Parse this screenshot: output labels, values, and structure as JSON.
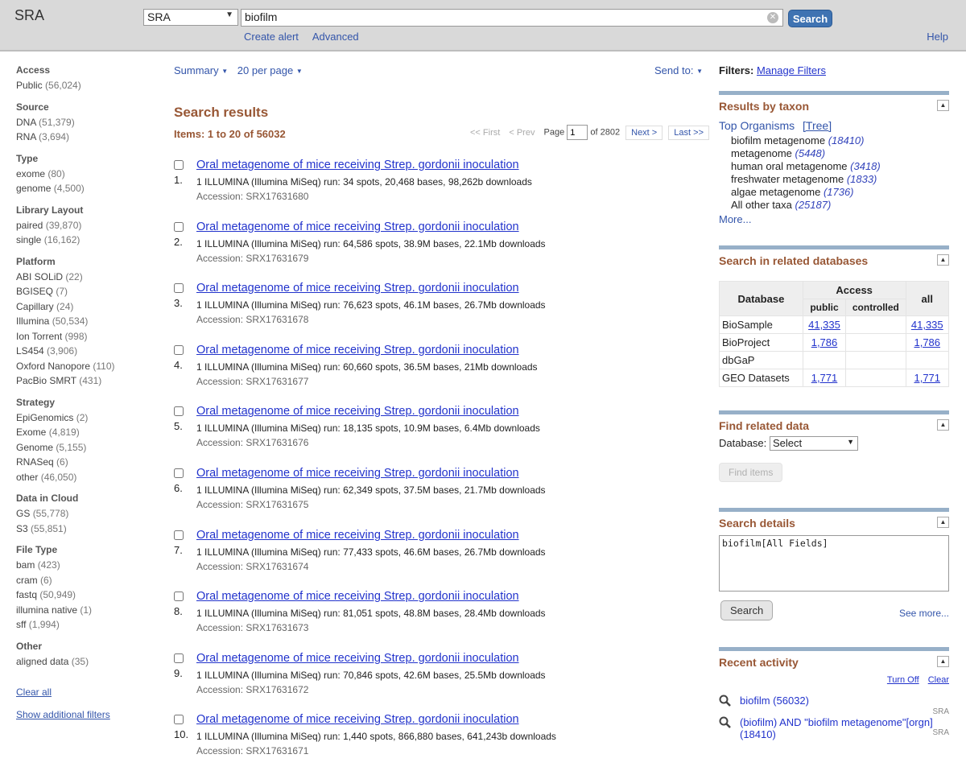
{
  "header": {
    "logo": "SRA",
    "db_selected": "SRA",
    "search_value": "biofilm",
    "search_button": "Search",
    "links": [
      "Create alert",
      "Advanced"
    ],
    "help": "Help"
  },
  "facets": [
    {
      "title": "Access",
      "items": [
        {
          "label": "Public",
          "count": "(56,024)"
        }
      ]
    },
    {
      "title": "Source",
      "items": [
        {
          "label": "DNA",
          "count": "(51,379)"
        },
        {
          "label": "RNA",
          "count": "(3,694)"
        }
      ]
    },
    {
      "title": "Type",
      "items": [
        {
          "label": "exome",
          "count": "(80)"
        },
        {
          "label": "genome",
          "count": "(4,500)"
        }
      ]
    },
    {
      "title": "Library Layout",
      "items": [
        {
          "label": "paired",
          "count": "(39,870)"
        },
        {
          "label": "single",
          "count": "(16,162)"
        }
      ]
    },
    {
      "title": "Platform",
      "items": [
        {
          "label": "ABI SOLiD",
          "count": "(22)"
        },
        {
          "label": "BGISEQ",
          "count": "(7)"
        },
        {
          "label": "Capillary",
          "count": "(24)"
        },
        {
          "label": "Illumina",
          "count": "(50,534)"
        },
        {
          "label": "Ion Torrent",
          "count": "(998)"
        },
        {
          "label": "LS454",
          "count": "(3,906)"
        },
        {
          "label": "Oxford Nanopore",
          "count": "(110)"
        },
        {
          "label": "PacBio SMRT",
          "count": "(431)"
        }
      ]
    },
    {
      "title": "Strategy",
      "items": [
        {
          "label": "EpiGenomics",
          "count": "(2)"
        },
        {
          "label": "Exome",
          "count": "(4,819)"
        },
        {
          "label": "Genome",
          "count": "(5,155)"
        },
        {
          "label": "RNASeq",
          "count": "(6)"
        },
        {
          "label": "other",
          "count": "(46,050)"
        }
      ]
    },
    {
      "title": "Data in Cloud",
      "items": [
        {
          "label": "GS",
          "count": "(55,778)"
        },
        {
          "label": "S3",
          "count": "(55,851)"
        }
      ]
    },
    {
      "title": "File Type",
      "items": [
        {
          "label": "bam",
          "count": "(423)"
        },
        {
          "label": "cram",
          "count": "(6)"
        },
        {
          "label": "fastq",
          "count": "(50,949)"
        },
        {
          "label": "illumina native",
          "count": "(1)"
        },
        {
          "label": "sff",
          "count": "(1,994)"
        }
      ]
    },
    {
      "title": "Other",
      "items": [
        {
          "label": "aligned data",
          "count": "(35)"
        }
      ]
    }
  ],
  "facet_links": {
    "clear_all": "Clear all",
    "show_additional": "Show additional filters"
  },
  "toolbar": {
    "summary": "Summary",
    "per_page": "20 per page",
    "send_to": "Send to:"
  },
  "results_title": "Search results",
  "items_label": "Items: 1 to 20 of 56032",
  "pager": {
    "first": "<< First",
    "prev": "< Prev",
    "page_label": "Page",
    "page_value": "1",
    "of": "of 2802",
    "next": "Next >",
    "last": "Last >>"
  },
  "results": [
    {
      "num": "1.",
      "title": "Oral metagenome of mice receiving Strep. gordonii inoculation",
      "desc": "1 ILLUMINA (Illumina MiSeq) run: 34 spots, 20,468 bases, 98,262b downloads",
      "accession": "Accession: SRX17631680"
    },
    {
      "num": "2.",
      "title": "Oral metagenome of mice receiving Strep. gordonii inoculation",
      "desc": "1 ILLUMINA (Illumina MiSeq) run: 64,586 spots, 38.9M bases, 22.1Mb downloads",
      "accession": "Accession: SRX17631679"
    },
    {
      "num": "3.",
      "title": "Oral metagenome of mice receiving Strep. gordonii inoculation",
      "desc": "1 ILLUMINA (Illumina MiSeq) run: 76,623 spots, 46.1M bases, 26.7Mb downloads",
      "accession": "Accession: SRX17631678"
    },
    {
      "num": "4.",
      "title": "Oral metagenome of mice receiving Strep. gordonii inoculation",
      "desc": "1 ILLUMINA (Illumina MiSeq) run: 60,660 spots, 36.5M bases, 21Mb downloads",
      "accession": "Accession: SRX17631677"
    },
    {
      "num": "5.",
      "title": "Oral metagenome of mice receiving Strep. gordonii inoculation",
      "desc": "1 ILLUMINA (Illumina MiSeq) run: 18,135 spots, 10.9M bases, 6.4Mb downloads",
      "accession": "Accession: SRX17631676"
    },
    {
      "num": "6.",
      "title": "Oral metagenome of mice receiving Strep. gordonii inoculation",
      "desc": "1 ILLUMINA (Illumina MiSeq) run: 62,349 spots, 37.5M bases, 21.7Mb downloads",
      "accession": "Accession: SRX17631675"
    },
    {
      "num": "7.",
      "title": "Oral metagenome of mice receiving Strep. gordonii inoculation",
      "desc": "1 ILLUMINA (Illumina MiSeq) run: 77,433 spots, 46.6M bases, 26.7Mb downloads",
      "accession": "Accession: SRX17631674"
    },
    {
      "num": "8.",
      "title": "Oral metagenome of mice receiving Strep. gordonii inoculation",
      "desc": "1 ILLUMINA (Illumina MiSeq) run: 81,051 spots, 48.8M bases, 28.4Mb downloads",
      "accession": "Accession: SRX17631673"
    },
    {
      "num": "9.",
      "title": "Oral metagenome of mice receiving Strep. gordonii inoculation",
      "desc": "1 ILLUMINA (Illumina MiSeq) run: 70,846 spots, 42.6M bases, 25.5Mb downloads",
      "accession": "Accession: SRX17631672"
    },
    {
      "num": "10.",
      "title": "Oral metagenome of mice receiving Strep. gordonii inoculation",
      "desc": "1 ILLUMINA (Illumina MiSeq) run: 1,440 spots, 866,880 bases, 641,243b downloads",
      "accession": "Accession: SRX17631671"
    }
  ],
  "right": {
    "filters_label": "Filters:",
    "manage_filters": "Manage Filters",
    "taxon": {
      "title": "Results by taxon",
      "top_organisms": "Top Organisms",
      "tree": "[Tree]",
      "organisms": [
        {
          "name": "biofilm metagenome",
          "count": "(18410)"
        },
        {
          "name": "metagenome",
          "count": "(5448)"
        },
        {
          "name": "human oral metagenome",
          "count": "(3418)"
        },
        {
          "name": "freshwater metagenome",
          "count": "(1833)"
        },
        {
          "name": "algae metagenome",
          "count": "(1736)"
        },
        {
          "name": "All other taxa",
          "count": "(25187)"
        }
      ],
      "more": "More..."
    },
    "related": {
      "title": "Search in related databases",
      "headers": {
        "database": "Database",
        "access": "Access",
        "public": "public",
        "controlled": "controlled",
        "all": "all"
      },
      "rows": [
        {
          "db": "BioSample",
          "public": "41,335",
          "controlled": "",
          "all": "41,335"
        },
        {
          "db": "BioProject",
          "public": "1,786",
          "controlled": "",
          "all": "1,786"
        },
        {
          "db": "dbGaP",
          "public": "",
          "controlled": "",
          "all": ""
        },
        {
          "db": "GEO Datasets",
          "public": "1,771",
          "controlled": "",
          "all": "1,771"
        }
      ]
    },
    "find_related": {
      "title": "Find related data",
      "db_label": "Database:",
      "db_selected": "Select",
      "find_button": "Find items"
    },
    "search_details": {
      "title": "Search details",
      "query": "biofilm[All Fields]",
      "search_button": "Search",
      "see_more": "See more..."
    },
    "recent": {
      "title": "Recent activity",
      "turn_off": "Turn Off",
      "clear": "Clear",
      "items": [
        {
          "text": "biofilm (56032)",
          "db": "SRA"
        },
        {
          "text": "(biofilm) AND \"biofilm metagenome\"[orgn] (18410)",
          "db": "SRA"
        }
      ]
    }
  },
  "colors": {
    "header_bg": "#d9d9d9",
    "accent_brown": "#985735",
    "link_blue": "#2233cc",
    "button_blue": "#3f73b2",
    "portlet_border": "#97b0c8"
  },
  "icons": {
    "search_history": "magnifier-icon",
    "collapse": "triangle-up-icon",
    "dropdown": "chevron-down-icon"
  }
}
